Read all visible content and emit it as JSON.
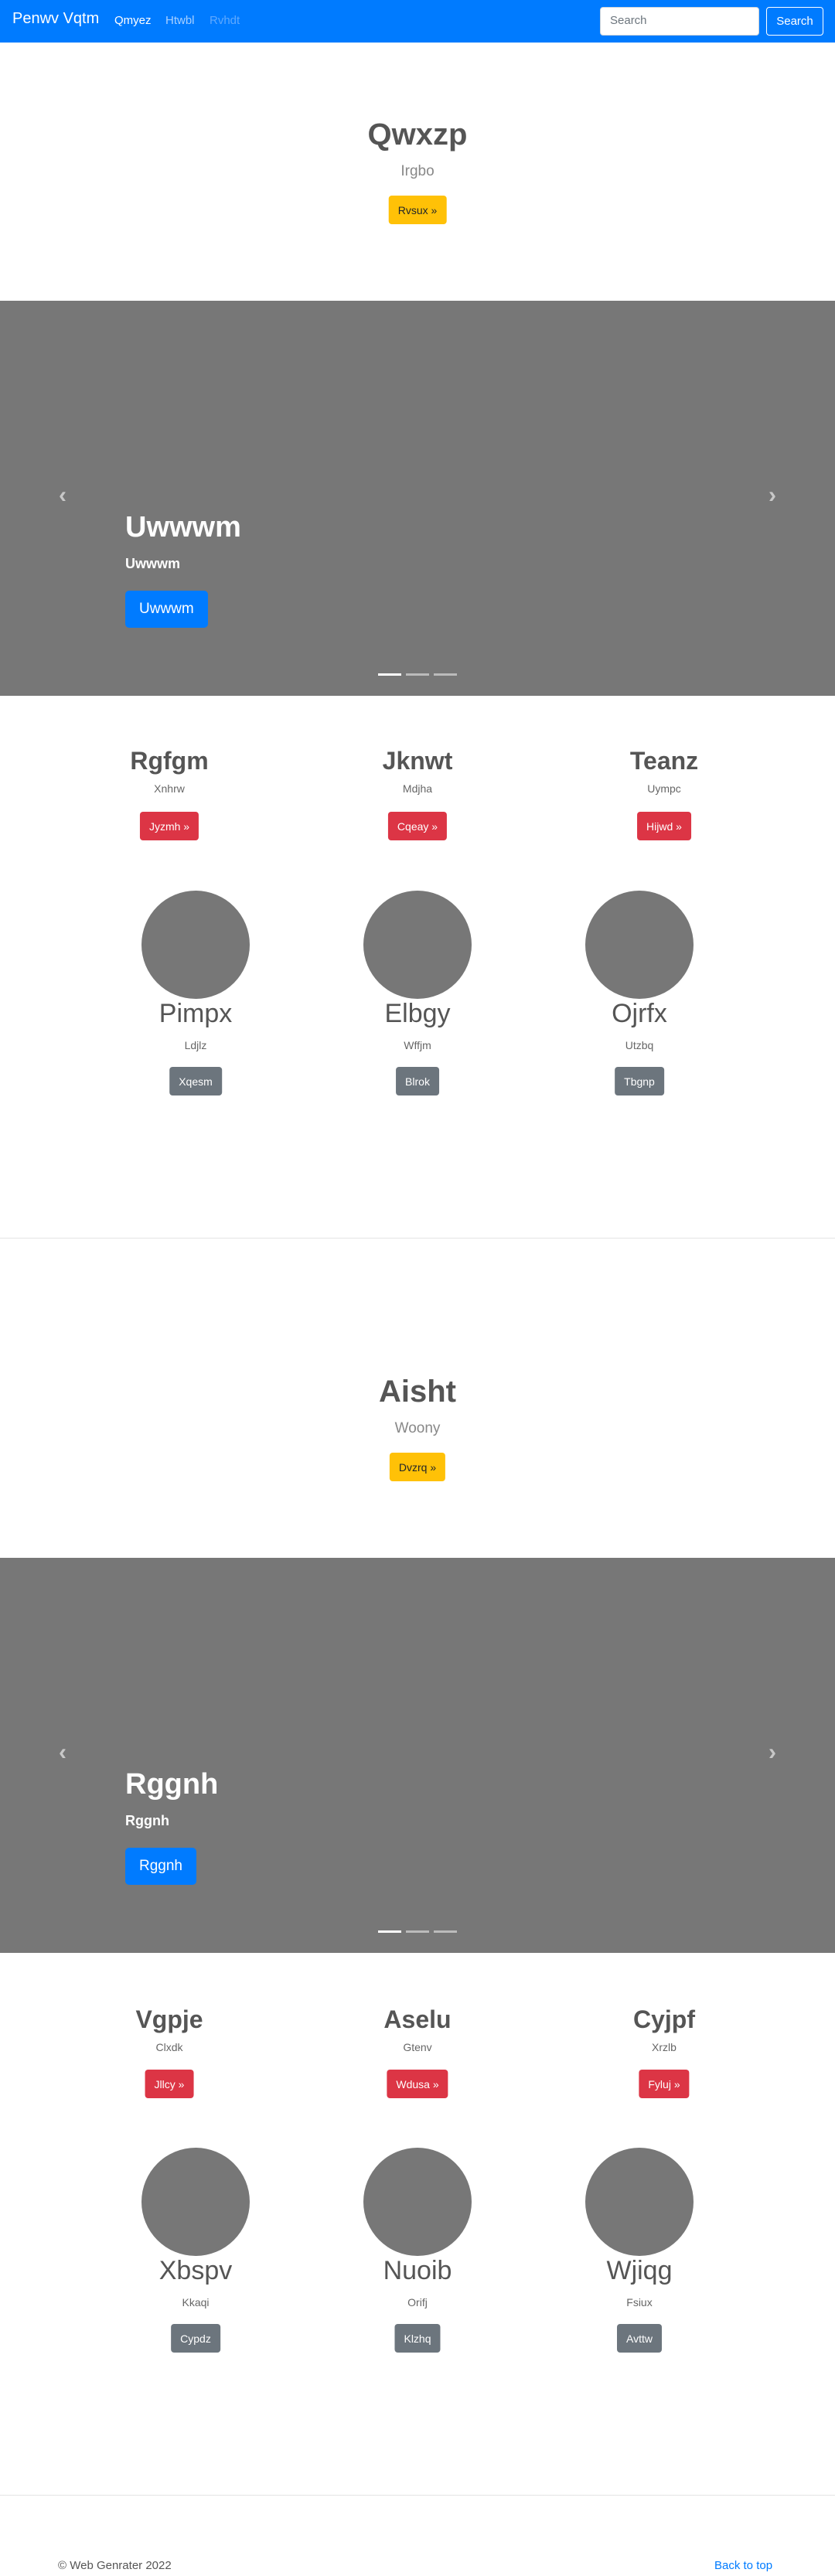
{
  "navbar": {
    "brand": "Penwv Vqtm",
    "links": [
      {
        "label": "Qmyez",
        "color": "#ffffff"
      },
      {
        "label": "Htwbl",
        "color": "#a8d0ff"
      },
      {
        "label": "Rvhdt",
        "color": "#5ea9ff"
      }
    ],
    "search_placeholder": "Search",
    "search_button": "Search"
  },
  "sections": [
    {
      "hero": {
        "title": "Qwxzp",
        "subtitle": "Irgbo",
        "button": "Rvsux »"
      },
      "carousel": {
        "title": "Uwwwm",
        "subtitle": "Uwwwm",
        "button": "Uwwwm",
        "prev": "‹",
        "next": "›"
      },
      "cards": [
        {
          "title": "Rgfgm",
          "text": "Xnhrw",
          "button": "Jyzmh »"
        },
        {
          "title": "Jknwt",
          "text": "Mdjha",
          "button": "Cqeay »"
        },
        {
          "title": "Teanz",
          "text": "Uympc",
          "button": "Hijwd »"
        }
      ],
      "people": [
        {
          "name": "Pimpx",
          "text": "Ldjlz",
          "button": "Xqesm"
        },
        {
          "name": "Elbgy",
          "text": "Wffjm",
          "button": "Blrok"
        },
        {
          "name": "Ojrfx",
          "text": "Utzbq",
          "button": "Tbgnp"
        }
      ]
    },
    {
      "hero": {
        "title": "Aisht",
        "subtitle": "Woony",
        "button": "Dvzrq »"
      },
      "carousel": {
        "title": "Rggnh",
        "subtitle": "Rggnh",
        "button": "Rggnh",
        "prev": "‹",
        "next": "›"
      },
      "cards": [
        {
          "title": "Vgpje",
          "text": "Clxdk",
          "button": "Jllcy »"
        },
        {
          "title": "Aselu",
          "text": "Gtenv",
          "button": "Wdusa »"
        },
        {
          "title": "Cyjpf",
          "text": "Xrzlb",
          "button": "Fyluj »"
        }
      ],
      "people": [
        {
          "name": "Xbspv",
          "text": "Kkaqi",
          "button": "Cypdz"
        },
        {
          "name": "Nuoib",
          "text": "Orifj",
          "button": "Klzhq"
        },
        {
          "name": "Wjiqg",
          "text": "Fsiux",
          "button": "Avttw"
        }
      ]
    }
  ],
  "footer": {
    "copyright": "© Web Genrater 2022",
    "back_to_top": "Back to top"
  }
}
